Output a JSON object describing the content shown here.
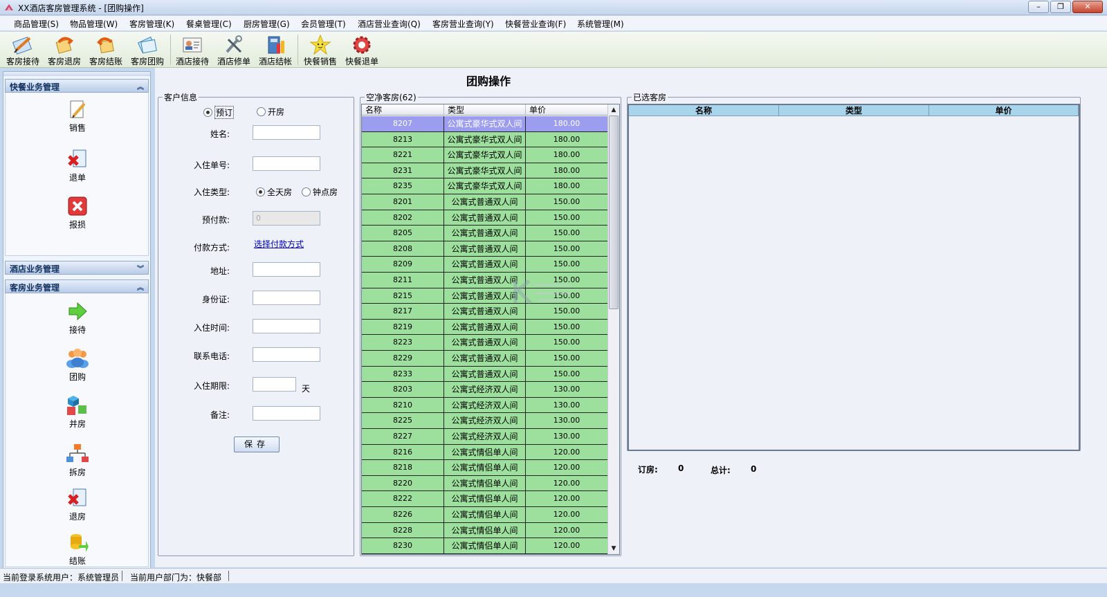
{
  "window": {
    "title": "XX酒店客房管理系统 - [团购操作]",
    "minimize": "–",
    "restore": "❐",
    "close": "✕"
  },
  "menu": [
    "商品管理(S)",
    "物品管理(W)",
    "客房管理(K)",
    "餐桌管理(C)",
    "厨房管理(G)",
    "会员管理(T)",
    "酒店营业查询(Q)",
    "客房营业查询(Y)",
    "快餐营业查询(F)",
    "系统管理(M)"
  ],
  "toolbar": [
    {
      "label": "客房接待",
      "icon": "pen-paper-icon"
    },
    {
      "label": "客房退房",
      "icon": "return-arrow-icon"
    },
    {
      "label": "客房结账",
      "icon": "undo-arrow-icon"
    },
    {
      "label": "客房团购",
      "icon": "cards-icon"
    },
    {
      "label": "酒店接待",
      "icon": "id-card-icon"
    },
    {
      "label": "酒店修单",
      "icon": "tools-icon"
    },
    {
      "label": "酒店结帐",
      "icon": "calculator-chart-icon"
    },
    {
      "label": "快餐销售",
      "icon": "star-smile-icon"
    },
    {
      "label": "快餐退单",
      "icon": "gear-red-icon"
    }
  ],
  "sidebar": {
    "groups": [
      {
        "title": "快餐业务管理",
        "expanded": true,
        "items": [
          {
            "label": "销售",
            "icon": "notepad-pencil-icon"
          },
          {
            "label": "退单",
            "icon": "doc-delete-icon"
          },
          {
            "label": "报损",
            "icon": "red-x-box-icon"
          }
        ]
      },
      {
        "title": "酒店业务管理",
        "expanded": false,
        "items": []
      },
      {
        "title": "客房业务管理",
        "expanded": true,
        "items": [
          {
            "label": "接待",
            "icon": "green-arrow-icon"
          },
          {
            "label": "团购",
            "icon": "people-group-icon"
          },
          {
            "label": "并房",
            "icon": "cubes-icon"
          },
          {
            "label": "拆房",
            "icon": "org-chart-icon"
          },
          {
            "label": "退房",
            "icon": "doc-delete-icon"
          },
          {
            "label": "结账",
            "icon": "coins-arrow-icon"
          }
        ]
      }
    ]
  },
  "page_title": "团购操作",
  "customer": {
    "legend": "客户信息",
    "mode_options": [
      "预订",
      "开房"
    ],
    "mode_selected": "预订",
    "fields": {
      "name_label": "姓名:",
      "checkin_no_label": "入住单号:",
      "checkin_type_label": "入住类型:",
      "checkin_type_options": [
        "全天房",
        "钟点房"
      ],
      "checkin_type_selected": "全天房",
      "prepay_label": "预付款:",
      "prepay_value": "0",
      "payment_label": "付款方式:",
      "payment_link": "选择付款方式",
      "address_label": "地址:",
      "id_label": "身份证:",
      "time_label": "入住时间:",
      "phone_label": "联系电话:",
      "period_label": "入住期限:",
      "period_unit": "天",
      "note_label": "备注:"
    },
    "save_button": "保存"
  },
  "vacant": {
    "legend": "空净客房(62)",
    "columns": [
      "名称",
      "类型",
      "单价"
    ],
    "rows": [
      [
        "8207",
        "公寓式豪华式双人间",
        "180.00"
      ],
      [
        "8213",
        "公寓式豪华式双人间",
        "180.00"
      ],
      [
        "8221",
        "公寓式豪华式双人间",
        "180.00"
      ],
      [
        "8231",
        "公寓式豪华式双人间",
        "180.00"
      ],
      [
        "8235",
        "公寓式豪华式双人间",
        "180.00"
      ],
      [
        "8201",
        "公寓式普通双人间",
        "150.00"
      ],
      [
        "8202",
        "公寓式普通双人间",
        "150.00"
      ],
      [
        "8205",
        "公寓式普通双人间",
        "150.00"
      ],
      [
        "8208",
        "公寓式普通双人间",
        "150.00"
      ],
      [
        "8209",
        "公寓式普通双人间",
        "150.00"
      ],
      [
        "8211",
        "公寓式普通双人间",
        "150.00"
      ],
      [
        "8215",
        "公寓式普通双人间",
        "150.00"
      ],
      [
        "8217",
        "公寓式普通双人间",
        "150.00"
      ],
      [
        "8219",
        "公寓式普通双人间",
        "150.00"
      ],
      [
        "8223",
        "公寓式普通双人间",
        "150.00"
      ],
      [
        "8229",
        "公寓式普通双人间",
        "150.00"
      ],
      [
        "8233",
        "公寓式普通双人间",
        "150.00"
      ],
      [
        "8203",
        "公寓式经济双人间",
        "130.00"
      ],
      [
        "8210",
        "公寓式经济双人间",
        "130.00"
      ],
      [
        "8225",
        "公寓式经济双人间",
        "130.00"
      ],
      [
        "8227",
        "公寓式经济双人间",
        "130.00"
      ],
      [
        "8216",
        "公寓式情侣单人间",
        "120.00"
      ],
      [
        "8218",
        "公寓式情侣单人间",
        "120.00"
      ],
      [
        "8220",
        "公寓式情侣单人间",
        "120.00"
      ],
      [
        "8222",
        "公寓式情侣单人间",
        "120.00"
      ],
      [
        "8226",
        "公寓式情侣单人间",
        "120.00"
      ],
      [
        "8228",
        "公寓式情侣单人间",
        "120.00"
      ],
      [
        "8230",
        "公寓式情侣单人间",
        "120.00"
      ]
    ],
    "selected_row": "8207"
  },
  "selected": {
    "legend": "已选客房",
    "columns": [
      "名称",
      "类型",
      "单价"
    ],
    "order_label": "订房:",
    "order_value": "0",
    "total_label": "总计:",
    "total_value": "0"
  },
  "status": {
    "user": "当前登录系统用户：系统管理员",
    "dept": "当前用户部门为：快餐部"
  },
  "colors": {
    "row_green": "#9ddf9d",
    "row_selected": "#9d9df0",
    "header_blue": "#a9d5ec"
  }
}
